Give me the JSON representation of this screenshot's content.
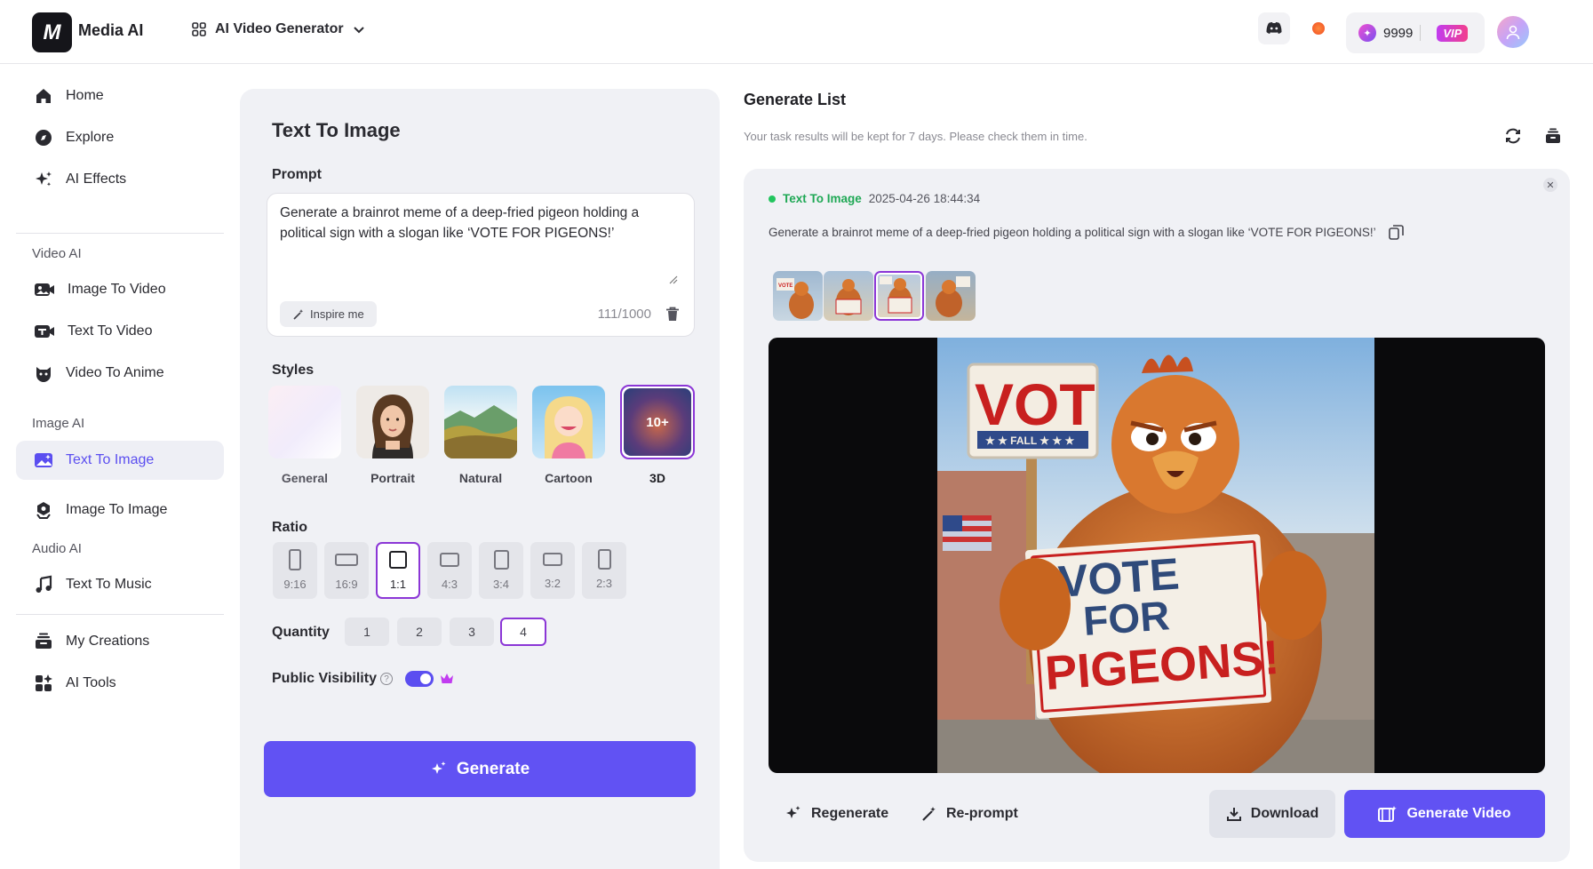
{
  "header": {
    "logo_text": "M",
    "brand": "Media AI",
    "tool_selector": "AI Video Generator",
    "credits": "9999",
    "vip_label": "VIP"
  },
  "sidebar": {
    "items": [
      {
        "label": "Home"
      },
      {
        "label": "Explore"
      },
      {
        "label": "AI Effects"
      }
    ],
    "video_section": "Video AI",
    "video_items": [
      {
        "label": "Image To Video"
      },
      {
        "label": "Text To Video"
      },
      {
        "label": "Video To Anime"
      }
    ],
    "image_section": "Image AI",
    "image_items": [
      {
        "label": "Text To Image"
      },
      {
        "label": "Image To Image"
      }
    ],
    "audio_section": "Audio AI",
    "audio_items": [
      {
        "label": "Text To Music"
      }
    ],
    "bottom_items": [
      {
        "label": "My Creations"
      },
      {
        "label": "AI Tools"
      }
    ]
  },
  "panel": {
    "title": "Text To Image",
    "prompt_label": "Prompt",
    "prompt_value": "Generate a brainrot meme of a deep-fried pigeon holding a political sign with a slogan like ‘VOTE FOR PIGEONS!’",
    "inspire_label": "Inspire me",
    "counter": "111/1000",
    "styles_label": "Styles",
    "styles": [
      {
        "label": "General"
      },
      {
        "label": "Portrait"
      },
      {
        "label": "Natural"
      },
      {
        "label": "Cartoon"
      },
      {
        "label": "3D",
        "badge": "10+"
      }
    ],
    "selected_style": "3D",
    "ratio_label": "Ratio",
    "ratios": [
      "9:16",
      "16:9",
      "1:1",
      "4:3",
      "3:4",
      "3:2",
      "2:3"
    ],
    "selected_ratio": "1:1",
    "quantity_label": "Quantity",
    "quantities": [
      "1",
      "2",
      "3",
      "4"
    ],
    "selected_quantity": "4",
    "visibility_label": "Public Visibility",
    "visibility_on": true,
    "generate_label": "Generate",
    "accent": "#6152f3"
  },
  "generate_list": {
    "title": "Generate List",
    "subtitle": "Your task results will be kept for 7 days. Please check them in time.",
    "task": {
      "type": "Text To Image",
      "timestamp": "2025-04-26 18:44:34",
      "prompt": "Generate a brainrot meme of a deep-fried pigeon holding a political sign with a slogan like ‘VOTE FOR PIGEONS!’",
      "thumbnail_count": 4,
      "selected_index": 2,
      "image_text": {
        "top_sign": "VOT",
        "top_sign_sub": "★ ★ FALL ★ ★ ★",
        "big_sign": [
          "VOTE",
          "FOR",
          "PIGEONS!"
        ]
      }
    },
    "regenerate_label": "Regenerate",
    "reprompt_label": "Re-prompt",
    "download_label": "Download",
    "generate_video_label": "Generate Video"
  }
}
